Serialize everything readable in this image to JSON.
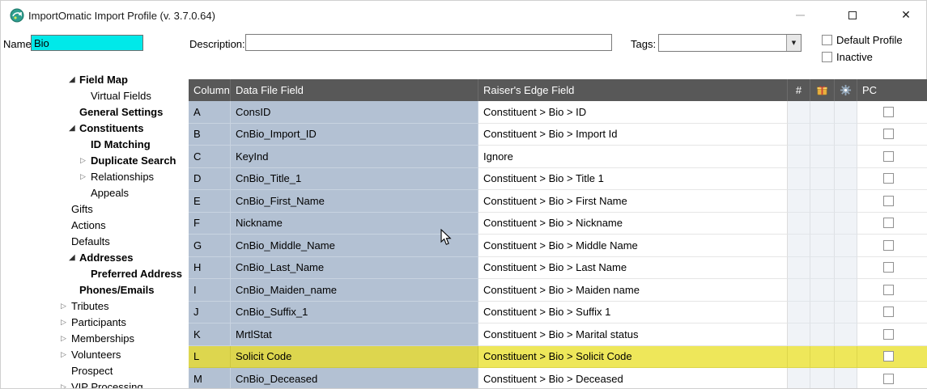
{
  "window": {
    "title": "ImportOmatic Import Profile (v. 3.7.0.64)"
  },
  "toolbar": {
    "name_label": "Name:",
    "name_value": "Bio",
    "description_label": "Description:",
    "description_value": "",
    "tags_label": "Tags:",
    "tags_value": "",
    "default_profile_label": "Default Profile",
    "inactive_label": "Inactive"
  },
  "sidebar": {
    "items": [
      {
        "label": "Field Map",
        "level": 1,
        "glyph": "expanded",
        "bold": true
      },
      {
        "label": "Virtual Fields",
        "level": 2,
        "glyph": "none",
        "bold": false
      },
      {
        "label": "General Settings",
        "level": 1,
        "glyph": "none",
        "bold": true
      },
      {
        "label": "Constituents",
        "level": 1,
        "glyph": "expanded",
        "bold": true
      },
      {
        "label": "ID Matching",
        "level": 2,
        "glyph": "none",
        "bold": true
      },
      {
        "label": "Duplicate Search",
        "level": 2,
        "glyph": "collapsed",
        "bold": true
      },
      {
        "label": "Relationships",
        "level": 2,
        "glyph": "collapsed",
        "bold": false
      },
      {
        "label": "Appeals",
        "level": 2,
        "glyph": "none",
        "bold": false
      },
      {
        "label": "Gifts",
        "level": 0,
        "glyph": "none",
        "bold": false
      },
      {
        "label": "Actions",
        "level": 0,
        "glyph": "none",
        "bold": false
      },
      {
        "label": "Defaults",
        "level": 0,
        "glyph": "none",
        "bold": false
      },
      {
        "label": "Addresses",
        "level": 1,
        "glyph": "expanded",
        "bold": true
      },
      {
        "label": "Preferred Address",
        "level": 2,
        "glyph": "none",
        "bold": true
      },
      {
        "label": "Phones/Emails",
        "level": 1,
        "glyph": "none",
        "bold": true
      },
      {
        "label": "Tributes",
        "level": 0,
        "glyph": "collapsed",
        "bold": false
      },
      {
        "label": "Participants",
        "level": 0,
        "glyph": "collapsed",
        "bold": false
      },
      {
        "label": "Memberships",
        "level": 0,
        "glyph": "collapsed",
        "bold": false
      },
      {
        "label": "Volunteers",
        "level": 0,
        "glyph": "collapsed",
        "bold": false
      },
      {
        "label": "Prospect",
        "level": 0,
        "glyph": "none",
        "bold": false
      },
      {
        "label": "VIP Processing",
        "level": 0,
        "glyph": "collapsed",
        "bold": false
      }
    ]
  },
  "table": {
    "headers": {
      "column": "Column",
      "data_file_field": "Data File Field",
      "raisers_edge_field": "Raiser's Edge Field",
      "number": "#",
      "gift_icon": "gift-icon",
      "gear_icon": "gear-icon",
      "pc": "PC"
    },
    "rows": [
      {
        "column": "A",
        "data_file_field": "ConsID",
        "raisers_edge_field": "Constituent > Bio > ID",
        "highlighted": false
      },
      {
        "column": "B",
        "data_file_field": "CnBio_Import_ID",
        "raisers_edge_field": "Constituent > Bio > Import Id",
        "highlighted": false
      },
      {
        "column": "C",
        "data_file_field": "KeyInd",
        "raisers_edge_field": "Ignore",
        "highlighted": false
      },
      {
        "column": "D",
        "data_file_field": "CnBio_Title_1",
        "raisers_edge_field": "Constituent > Bio > Title 1",
        "highlighted": false
      },
      {
        "column": "E",
        "data_file_field": "CnBio_First_Name",
        "raisers_edge_field": "Constituent > Bio > First Name",
        "highlighted": false
      },
      {
        "column": "F",
        "data_file_field": "Nickname",
        "raisers_edge_field": "Constituent > Bio > Nickname",
        "highlighted": false
      },
      {
        "column": "G",
        "data_file_field": "CnBio_Middle_Name",
        "raisers_edge_field": "Constituent > Bio > Middle Name",
        "highlighted": false
      },
      {
        "column": "H",
        "data_file_field": "CnBio_Last_Name",
        "raisers_edge_field": "Constituent > Bio > Last Name",
        "highlighted": false
      },
      {
        "column": "I",
        "data_file_field": "CnBio_Maiden_name",
        "raisers_edge_field": "Constituent > Bio > Maiden name",
        "highlighted": false
      },
      {
        "column": "J",
        "data_file_field": "CnBio_Suffix_1",
        "raisers_edge_field": "Constituent > Bio > Suffix 1",
        "highlighted": false
      },
      {
        "column": "K",
        "data_file_field": "MrtlStat",
        "raisers_edge_field": "Constituent > Bio > Marital status",
        "highlighted": false
      },
      {
        "column": "L",
        "data_file_field": "Solicit Code",
        "raisers_edge_field": "Constituent > Bio > Solicit Code",
        "highlighted": true
      },
      {
        "column": "M",
        "data_file_field": "CnBio_Deceased",
        "raisers_edge_field": "Constituent > Bio > Deceased",
        "highlighted": false
      }
    ]
  },
  "colors": {
    "name_field_bg": "#00e9e9",
    "table_header_bg": "#585858",
    "row_blue": "#b3c1d3",
    "highlight_yellow": "#eee75a"
  }
}
